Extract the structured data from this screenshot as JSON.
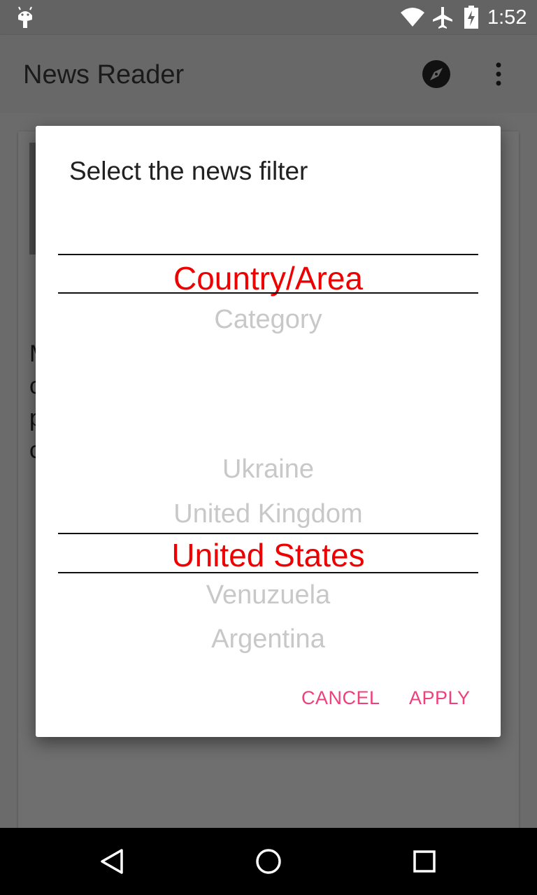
{
  "status_bar": {
    "time": "1:52",
    "icons": [
      "android-icon",
      "wifi-icon",
      "airplane-icon",
      "battery-charging-icon"
    ]
  },
  "app_bar": {
    "title": "News Reader",
    "actions": [
      "compass-icon",
      "more-vert-icon"
    ]
  },
  "background": {
    "partial_text_lines": [
      "M",
      "c",
      "p",
      "c"
    ]
  },
  "dialog": {
    "title": "Select the news filter",
    "filter_picker": {
      "items": [
        "Country/Area",
        "Category"
      ],
      "selected": "Country/Area"
    },
    "value_picker": {
      "items_above": [
        "Ukraine",
        "United Kingdom"
      ],
      "selected": "United States",
      "items_below": [
        "Venuzuela",
        "Argentina"
      ]
    },
    "cancel_label": "CANCEL",
    "apply_label": "APPLY"
  },
  "nav_bar": {
    "buttons": [
      "back-icon",
      "home-icon",
      "recents-icon"
    ]
  },
  "colors": {
    "accent": "#f0407a",
    "selected_text": "#ee0000",
    "unselected_text": "#c8c8c8",
    "scrim": "#6b6b6b"
  }
}
